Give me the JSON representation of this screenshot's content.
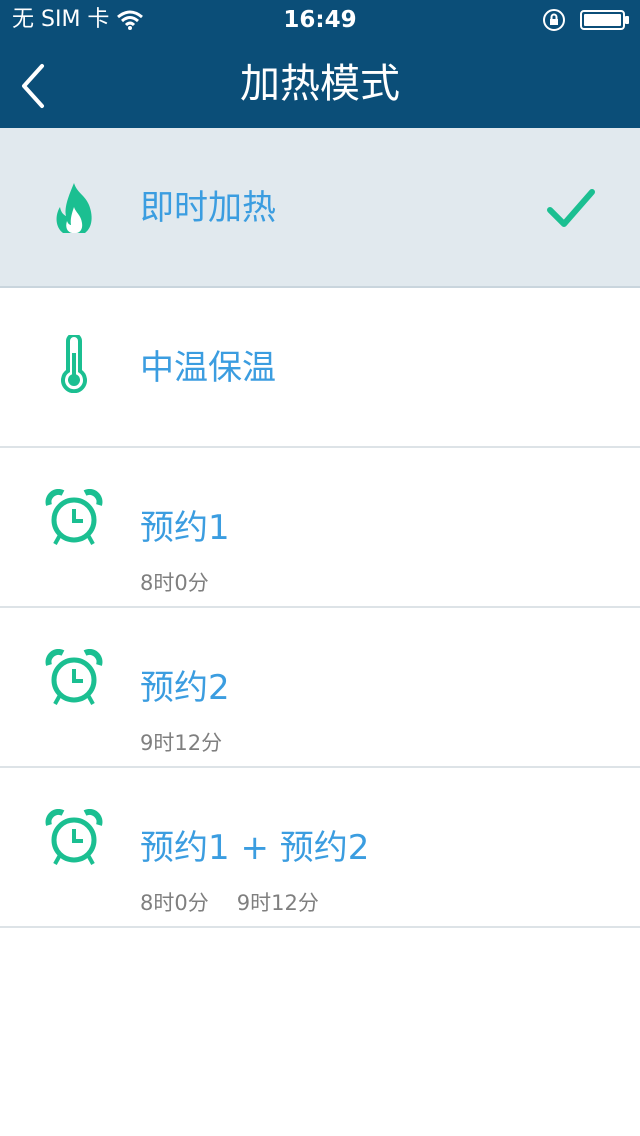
{
  "status_bar": {
    "carrier": "无 SIM 卡",
    "time": "16:49",
    "icons": [
      "wifi-icon",
      "rotation-lock-icon",
      "battery-icon"
    ]
  },
  "nav": {
    "title": "加热模式",
    "back_icon": "chevron-left-icon"
  },
  "colors": {
    "nav_background": "#0b4e78",
    "accent_green": "#1bbf91",
    "title_blue": "#3b9de0",
    "selected_background": "#e1e9ee"
  },
  "modes": [
    {
      "title": "即时加热",
      "icon": "flame-icon",
      "selected": true,
      "times": []
    },
    {
      "title": "中温保温",
      "icon": "thermometer-icon",
      "selected": false,
      "times": []
    },
    {
      "title": "预约1",
      "icon": "alarm-clock-icon",
      "selected": false,
      "times": [
        "8时0分"
      ]
    },
    {
      "title": "预约2",
      "icon": "alarm-clock-icon",
      "selected": false,
      "times": [
        "9时12分"
      ]
    },
    {
      "title": "预约1 + 预约2",
      "icon": "alarm-clock-icon",
      "selected": false,
      "times": [
        "8时0分",
        "9时12分"
      ]
    }
  ]
}
